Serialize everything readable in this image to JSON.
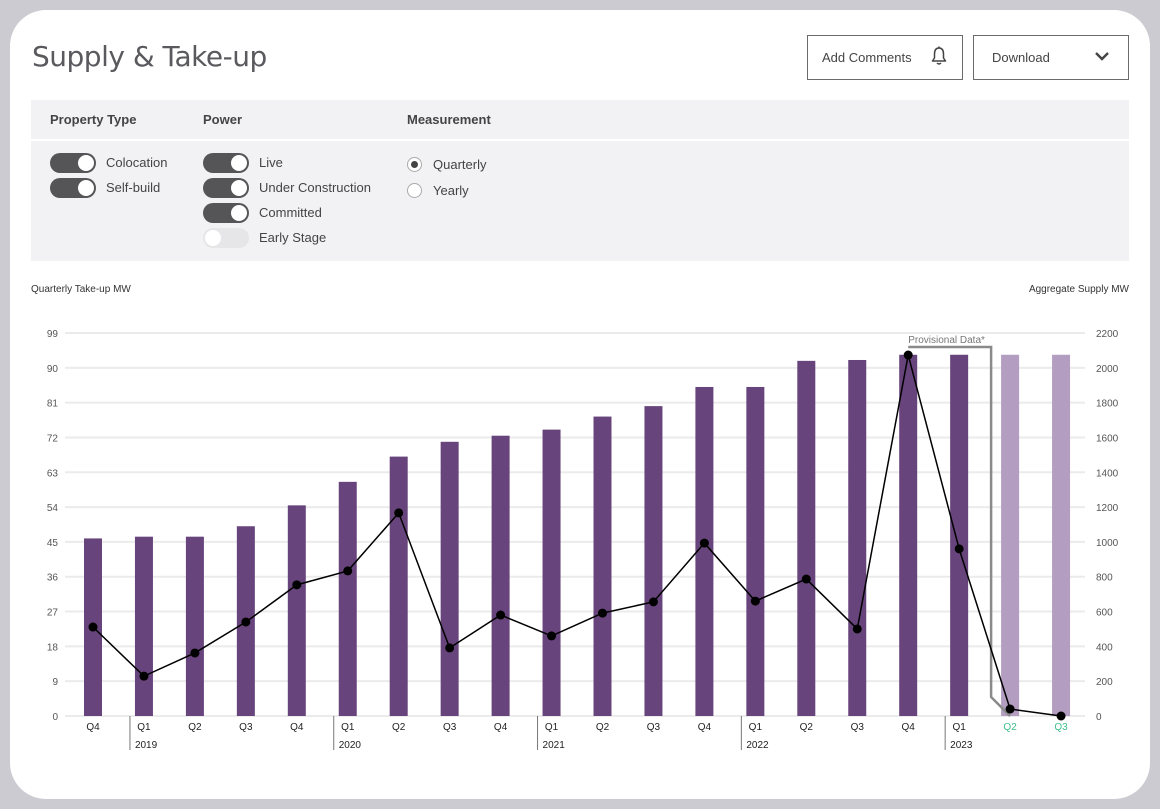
{
  "header": {
    "title": "Supply & Take-up",
    "add_comments_label": "Add Comments",
    "add_comments_icon": "bell-icon",
    "download_label": "Download",
    "download_icon": "chevron-down-icon"
  },
  "filters": {
    "property_type": {
      "label": "Property Type",
      "options": [
        {
          "label": "Colocation",
          "on": true
        },
        {
          "label": "Self-build",
          "on": true
        }
      ]
    },
    "power": {
      "label": "Power",
      "options": [
        {
          "label": "Live",
          "on": true
        },
        {
          "label": "Under Construction",
          "on": true
        },
        {
          "label": "Committed",
          "on": true
        },
        {
          "label": "Early Stage",
          "on": false
        }
      ]
    },
    "measurement": {
      "label": "Measurement",
      "options": [
        {
          "label": "Quarterly",
          "selected": true
        },
        {
          "label": "Yearly",
          "selected": false
        }
      ]
    }
  },
  "colors": {
    "bar": "#68447c",
    "bar_provisional": "#b39dc0",
    "line": "#000000",
    "provisional_label": "#3dbf8a",
    "grid": "#ebebeb",
    "bracket": "#8a8a8a"
  },
  "chart_data": {
    "type": "bar",
    "title": "Supply & Take-up",
    "ylabel_left": "Quarterly Take-up MW",
    "ylabel_right": "Aggregate Supply MW",
    "ylim_left": [
      0,
      99
    ],
    "yticks_left": [
      0,
      9,
      18,
      27,
      36,
      45,
      54,
      63,
      72,
      81,
      90,
      99
    ],
    "ylim_right": [
      0,
      2200
    ],
    "yticks_right": [
      0,
      200,
      400,
      600,
      800,
      1000,
      1200,
      1400,
      1600,
      1800,
      2000,
      2200
    ],
    "grid": true,
    "categories": [
      "Q4",
      "Q1",
      "Q2",
      "Q3",
      "Q4",
      "Q1",
      "Q2",
      "Q3",
      "Q4",
      "Q1",
      "Q2",
      "Q3",
      "Q4",
      "Q1",
      "Q2",
      "Q3",
      "Q4",
      "Q1",
      "Q2",
      "Q3"
    ],
    "years": [
      {
        "label": "2019",
        "start_index": 1
      },
      {
        "label": "2020",
        "start_index": 5
      },
      {
        "label": "2021",
        "start_index": 9
      },
      {
        "label": "2022",
        "start_index": 13
      },
      {
        "label": "2023",
        "start_index": 17
      }
    ],
    "provisional_from_index": 18,
    "provisional_label": "Provisional Data*",
    "series": [
      {
        "name": "Aggregate Supply MW",
        "type": "bar",
        "axis": "right",
        "values": [
          1020,
          1030,
          1030,
          1090,
          1210,
          1345,
          1490,
          1575,
          1610,
          1645,
          1720,
          1780,
          1890,
          1890,
          2040,
          2045,
          2075,
          2075,
          2075,
          2075
        ]
      },
      {
        "name": "Quarterly Take-up MW",
        "type": "line",
        "axis": "left",
        "values": [
          23.0,
          10.3,
          16.3,
          24.3,
          33.9,
          37.5,
          52.5,
          17.6,
          26.1,
          20.7,
          26.6,
          29.5,
          44.7,
          29.7,
          35.4,
          22.5,
          93.3,
          43.2,
          1.8,
          0
        ]
      }
    ]
  }
}
